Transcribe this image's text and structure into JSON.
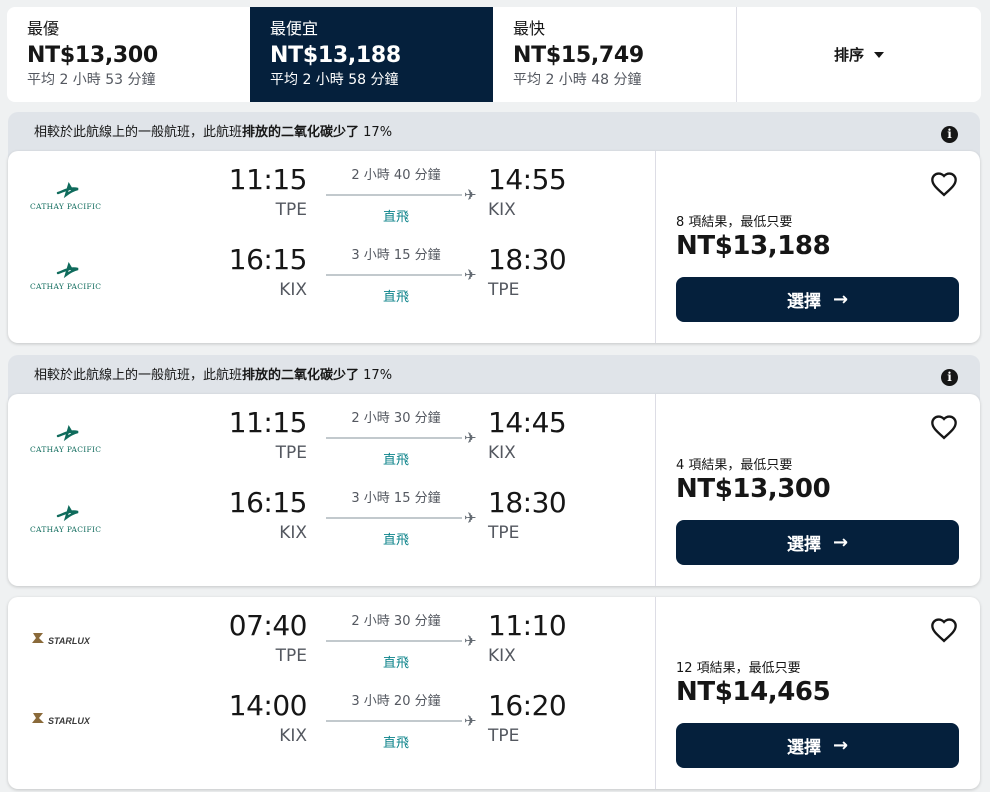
{
  "sort_tabs": [
    {
      "label": "最優",
      "price": "NT$13,300",
      "avg": "平均 2 小時 53 分鐘"
    },
    {
      "label": "最便宜",
      "price": "NT$13,188",
      "avg": "平均 2 小時 58 分鐘"
    },
    {
      "label": "最快",
      "price": "NT$15,749",
      "avg": "平均 2 小時 48 分鐘"
    }
  ],
  "sort_label": "排序",
  "eco": {
    "prefix": "相較於此航線上的一般航班，此航班",
    "emph": "排放的二氧化碳少了",
    "pct": " 17%",
    "info_icon": "i"
  },
  "direct_label": "直飛",
  "select_label": "選擇",
  "arrow": "→",
  "plane": "✈",
  "colors": {
    "navy": "#05203c",
    "teal": "#0c838a",
    "cathay": "#0f6b5c"
  },
  "cards": [
    {
      "results": "8 項結果，最低只要",
      "price": "NT$13,188",
      "legs": [
        {
          "airline": "CATHAY PACIFIC",
          "dep_time": "11:15",
          "dep_code": "TPE",
          "duration": "2 小時 40 分鐘",
          "arr_time": "14:55",
          "arr_code": "KIX"
        },
        {
          "airline": "CATHAY PACIFIC",
          "dep_time": "16:15",
          "dep_code": "KIX",
          "duration": "3 小時 15 分鐘",
          "arr_time": "18:30",
          "arr_code": "TPE"
        }
      ]
    },
    {
      "results": "4 項結果，最低只要",
      "price": "NT$13,300",
      "legs": [
        {
          "airline": "CATHAY PACIFIC",
          "dep_time": "11:15",
          "dep_code": "TPE",
          "duration": "2 小時 30 分鐘",
          "arr_time": "14:45",
          "arr_code": "KIX"
        },
        {
          "airline": "CATHAY PACIFIC",
          "dep_time": "16:15",
          "dep_code": "KIX",
          "duration": "3 小時 15 分鐘",
          "arr_time": "18:30",
          "arr_code": "TPE"
        }
      ]
    },
    {
      "results": "12 項結果，最低只要",
      "price": "NT$14,465",
      "legs": [
        {
          "airline": "STARLUX",
          "dep_time": "07:40",
          "dep_code": "TPE",
          "duration": "2 小時 30 分鐘",
          "arr_time": "11:10",
          "arr_code": "KIX"
        },
        {
          "airline": "STARLUX",
          "dep_time": "14:00",
          "dep_code": "KIX",
          "duration": "3 小時 20 分鐘",
          "arr_time": "16:20",
          "arr_code": "TPE"
        }
      ]
    }
  ]
}
